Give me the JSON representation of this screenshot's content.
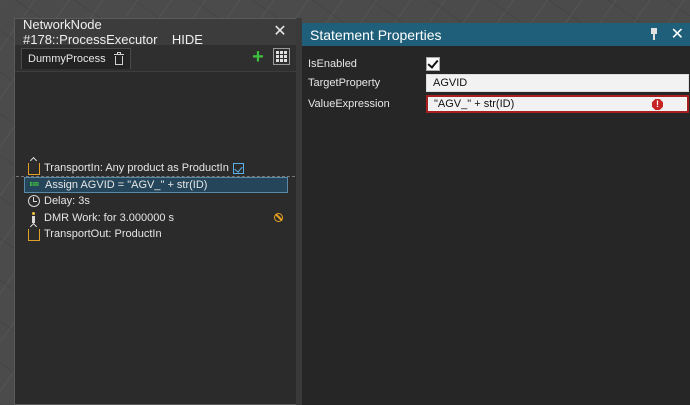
{
  "left_panel": {
    "title": "NetworkNode #178::ProcessExecutor__HIDE__",
    "close_glyph": "✕",
    "process_tab": "DummyProcess",
    "add_glyph": "+",
    "statements": [
      {
        "text": "TransportIn: Any product as ProductIn",
        "icon": "transport-in-icon",
        "selected": false
      },
      {
        "text": "Assign AGVID = \"AGV_\" + str(ID)",
        "icon": "assign-icon",
        "selected": true
      },
      {
        "text": "Delay: 3s",
        "icon": "clock-icon",
        "selected": false
      },
      {
        "text": "DMR Work: for 3.000000 s",
        "icon": "worker-icon",
        "selected": false
      },
      {
        "text": "TransportOut: ProductIn",
        "icon": "transport-out-icon",
        "selected": false
      }
    ]
  },
  "right_panel": {
    "title": "Statement Properties",
    "close_glyph": "✕",
    "properties": {
      "is_enabled": {
        "label": "IsEnabled",
        "checked": true
      },
      "target_property": {
        "label": "TargetProperty",
        "value": "AGVID"
      },
      "value_expression": {
        "label": "ValueExpression",
        "value": "\"AGV_\" + str(ID)",
        "error_glyph": "!"
      }
    }
  },
  "colors": {
    "accent": "#1f5f7a",
    "selection": "#25465a",
    "error": "#c62424",
    "add_green": "#3fbf3f"
  }
}
